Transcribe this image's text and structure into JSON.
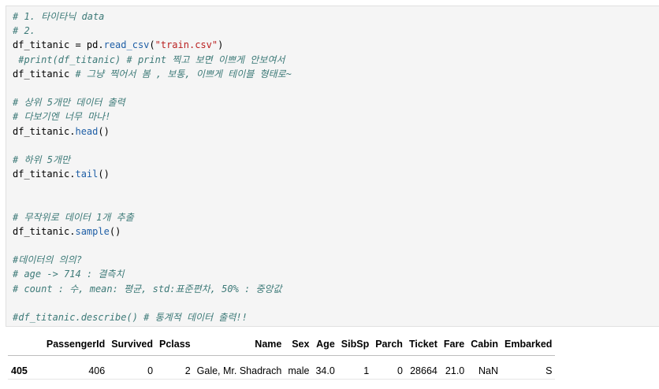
{
  "code": {
    "l1": "# 1. 타이타닉 data",
    "l2": "# 2.",
    "l3_a": "df_titanic = pd.",
    "l3_fn": "read_csv",
    "l3_b": "(",
    "l3_str": "\"train.csv\"",
    "l3_c": ")",
    "l4": " #print(df_titanic) # print 찍고 보면 이쁘게 안보여서",
    "l5_a": "df_titanic ",
    "l5_c": "# 그냥 찍어서 봄 , 보통, 이쁘게 테이블 형태로~",
    "l6": "",
    "l7": "# 상위 5개만 데이터 출력",
    "l8": "# 다보기엔 너무 마나!",
    "l9_a": "df_titanic.",
    "l9_fn": "head",
    "l9_b": "()",
    "l10": "",
    "l11": "# 하위 5개만",
    "l12_a": "df_titanic.",
    "l12_fn": "tail",
    "l12_b": "()",
    "l13": "",
    "l14": "",
    "l15": "# 무작위로 데이터 1개 추출",
    "l16_a": "df_titanic.",
    "l16_fn": "sample",
    "l16_b": "()",
    "l17": "",
    "l18": "#데이터의 의의?",
    "l19": "# age -> 714 : 결측치",
    "l20": "# count : 수, mean: 평균, std:표준편차, 50% : 중앙값",
    "l21": "",
    "l22": "#df_titanic.describe() # 통계적 데이터 출력!!"
  },
  "output_table": {
    "columns": [
      "PassengerId",
      "Survived",
      "Pclass",
      "Name",
      "Sex",
      "Age",
      "SibSp",
      "Parch",
      "Ticket",
      "Fare",
      "Cabin",
      "Embarked"
    ],
    "row": {
      "index": "405",
      "cells": [
        "406",
        "0",
        "2",
        "Gale, Mr. Shadrach",
        "male",
        "34.0",
        "1",
        "0",
        "28664",
        "21.0",
        "NaN",
        "S"
      ]
    }
  },
  "colors": {
    "comment": "#3d7a78",
    "string": "#ba2121",
    "function": "#1f5fa6",
    "cell_background": "#f5f5f5"
  }
}
